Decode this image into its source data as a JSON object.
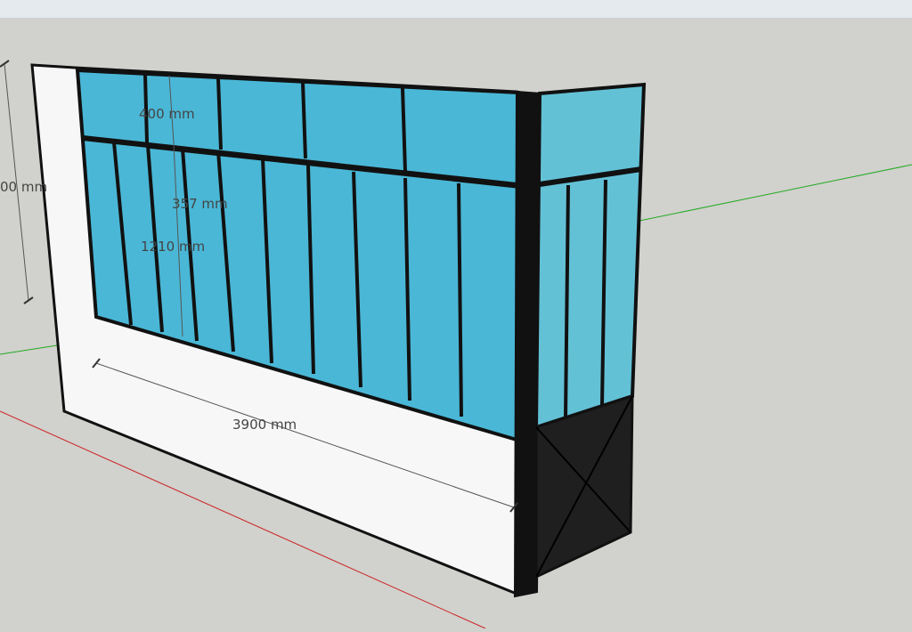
{
  "app": {
    "view": "SketchUp 3D model viewport"
  },
  "dimensions": {
    "height_total": "00 mm",
    "top_band": "400 mm",
    "middle": "357 mm",
    "glazing": "1210 mm",
    "width": "3900 mm"
  },
  "colors": {
    "background": "#d1d1cd",
    "glass": "#4ab7d6",
    "glass_side": "#63c1d6",
    "frame": "#111111",
    "wall": "#f7f7f7",
    "axis_red": "#cc2222",
    "axis_green": "#22aa22",
    "dimension_line": "#555555"
  }
}
